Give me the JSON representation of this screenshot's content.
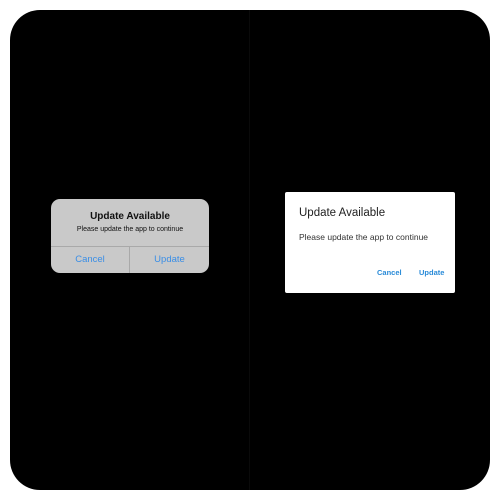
{
  "ios_alert": {
    "title": "Update Available",
    "message": "Please update the app to continue",
    "cancel_label": "Cancel",
    "update_label": "Update"
  },
  "material_alert": {
    "title": "Update Available",
    "message": "Please update the app to continue",
    "cancel_label": "Cancel",
    "update_label": "Update"
  },
  "colors": {
    "background": "#000000",
    "ios_dialog": "#c9c9c9",
    "material_dialog": "#ffffff",
    "button_accent": "#3a8ee6"
  }
}
